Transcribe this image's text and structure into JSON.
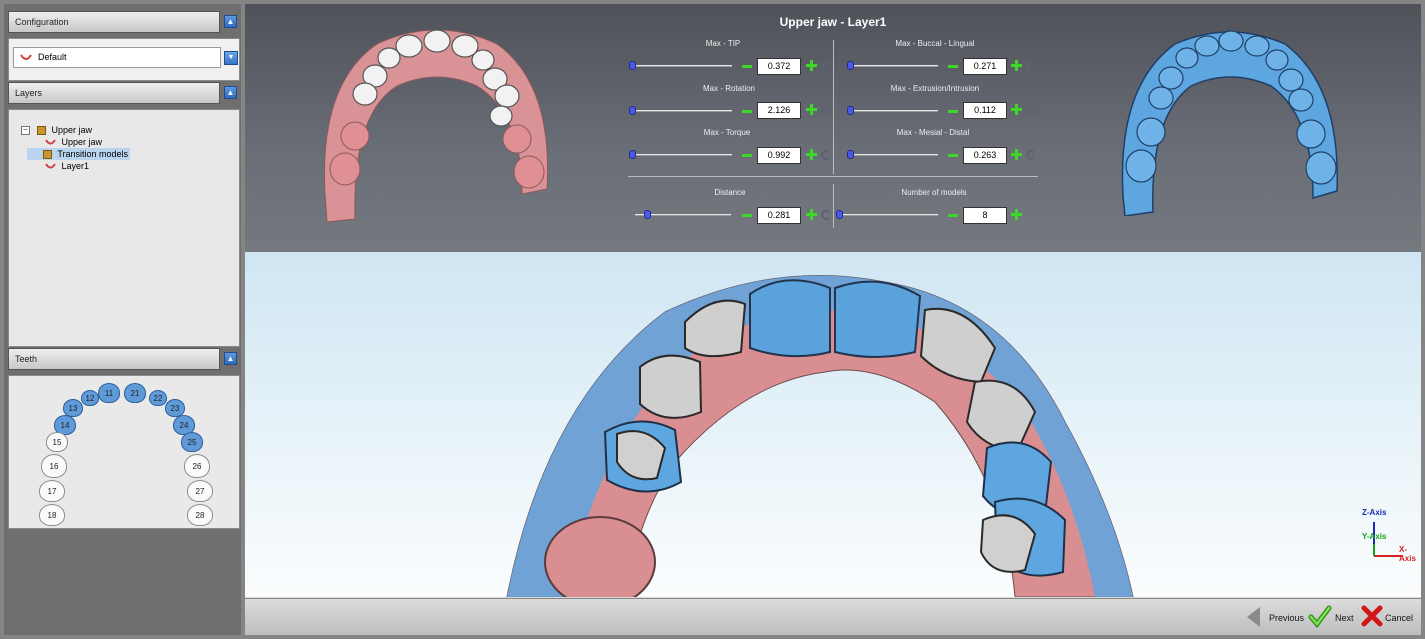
{
  "sidebar": {
    "configuration": {
      "title": "Configuration",
      "selected": "Default"
    },
    "layers": {
      "title": "Layers",
      "items": [
        {
          "label": "Upper jaw"
        },
        {
          "label": "Upper jaw"
        },
        {
          "label": "Transition models"
        },
        {
          "label": "Layer1"
        }
      ]
    },
    "teeth": {
      "title": "Teeth",
      "items": [
        {
          "label": "11",
          "selected": true
        },
        {
          "label": "21",
          "selected": true
        },
        {
          "label": "12",
          "selected": true
        },
        {
          "label": "22",
          "selected": true
        },
        {
          "label": "13",
          "selected": true
        },
        {
          "label": "23",
          "selected": true
        },
        {
          "label": "14",
          "selected": true
        },
        {
          "label": "24",
          "selected": true
        },
        {
          "label": "15",
          "selected": false
        },
        {
          "label": "25",
          "selected": true
        },
        {
          "label": "16",
          "selected": false
        },
        {
          "label": "26",
          "selected": false
        },
        {
          "label": "17",
          "selected": false
        },
        {
          "label": "27",
          "selected": false
        },
        {
          "label": "18",
          "selected": false
        },
        {
          "label": "28",
          "selected": false
        }
      ]
    }
  },
  "main": {
    "title": "Upper jaw - Layer1",
    "params": [
      {
        "label": "Max - TIP",
        "value": "0.372",
        "level": 0.0
      },
      {
        "label": "Max - Buccal - Lingual",
        "value": "0.271",
        "level": 0.0
      },
      {
        "label": "Max - Rotation",
        "value": "2.126",
        "level": 0.0
      },
      {
        "label": "Max - Extrusion/Intrusion",
        "value": "0.112",
        "level": 0.0
      },
      {
        "label": "Max - Torque",
        "value": "0.992",
        "level": 0.0
      },
      {
        "label": "Max - Mesial - Distal",
        "value": "0.263",
        "level": 0.0
      },
      {
        "label": "Distance",
        "value": "0.281",
        "level": 0.1
      },
      {
        "label": "Number of models",
        "value": "8",
        "level": 0.0
      }
    ],
    "axes": {
      "z": "Z-Axis",
      "y": "Y-Axis",
      "x": "X-Axis"
    }
  },
  "footer": {
    "previous": "Previous",
    "next": "Next",
    "cancel": "Cancel"
  },
  "colors": {
    "accent": "#2f6cc0",
    "gum": "#d98f92",
    "model_blue": "#5ea6e0",
    "plus_minus": "#3fd62a"
  }
}
